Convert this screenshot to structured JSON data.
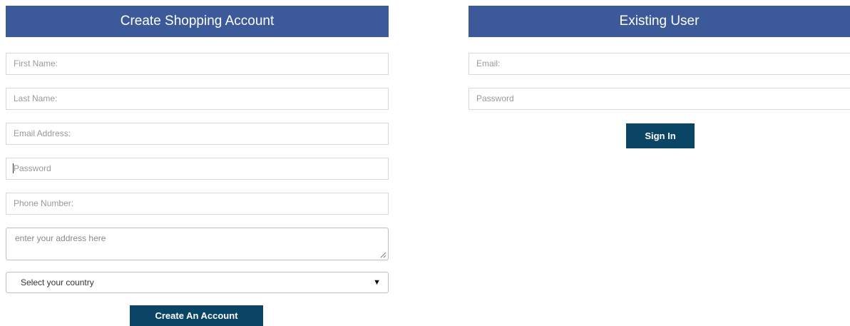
{
  "create_account": {
    "title": "Create Shopping Account",
    "first_name_placeholder": "First Name:",
    "last_name_placeholder": "Last Name:",
    "email_placeholder": "Email Address:",
    "password_placeholder": "Password",
    "phone_placeholder": "Phone Number:",
    "address_placeholder": "enter your address here",
    "country_selected": "Select your country",
    "submit_label": "Create An Account"
  },
  "existing_user": {
    "title": "Existing User",
    "email_placeholder": "Email:",
    "password_placeholder": "Password",
    "submit_label": "Sign In"
  },
  "icons": {
    "select_arrow": "dropdown-arrow-icon",
    "resize": "resize-grip-icon"
  },
  "colors": {
    "header_bg": "#3c5a9a",
    "button_bg": "#0a4566"
  }
}
